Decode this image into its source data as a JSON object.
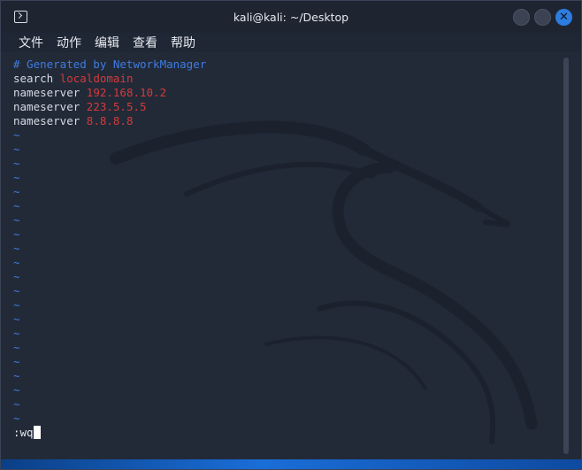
{
  "window": {
    "title": "kali@kali: ~/Desktop",
    "close_glyph": "✕"
  },
  "menu": [
    "文件",
    "动作",
    "编辑",
    "查看",
    "帮助"
  ],
  "editor": {
    "lines": [
      {
        "parts": [
          {
            "cls": "comment",
            "text": "# Generated by NetworkManager"
          }
        ]
      },
      {
        "parts": [
          {
            "cls": "kw",
            "text": "search "
          },
          {
            "cls": "val",
            "text": "localdomain"
          }
        ]
      },
      {
        "parts": [
          {
            "cls": "kw",
            "text": "nameserver "
          },
          {
            "cls": "val",
            "text": "192.168.10.2"
          }
        ]
      },
      {
        "parts": [
          {
            "cls": "kw",
            "text": "nameserver "
          },
          {
            "cls": "val",
            "text": "223.5.5.5"
          }
        ]
      },
      {
        "parts": [
          {
            "cls": "kw",
            "text": "nameserver "
          },
          {
            "cls": "val",
            "text": "8.8.8.8"
          }
        ]
      }
    ],
    "empty_line_marker": "~",
    "empty_line_count": 21,
    "command_line": ":wq"
  },
  "colors": {
    "comment": "#3f7be0",
    "keyword": "#d6dbe3",
    "value": "#d43a3a",
    "accent": "#2d7de0"
  }
}
